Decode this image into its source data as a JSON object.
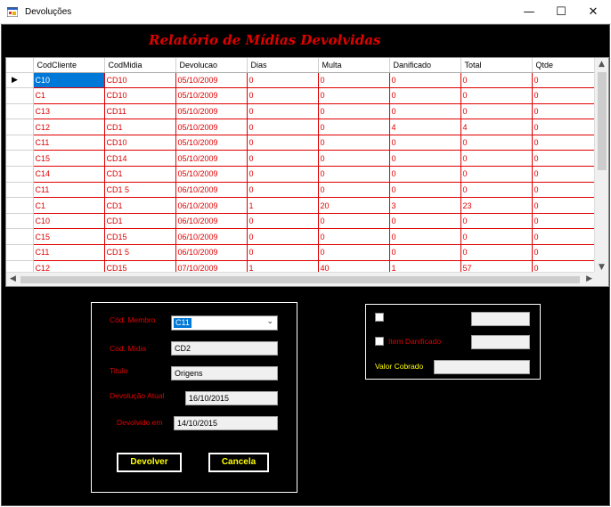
{
  "window": {
    "title": "Devoluções",
    "minimize": "—",
    "maximize": "☐",
    "close": "✕"
  },
  "report": {
    "title": "Relatório de Mídias Devolvidas"
  },
  "grid": {
    "columns": [
      "CodCliente",
      "CodMidia",
      "Devolucao",
      "Dias",
      "Multa",
      "Danificado",
      "Total",
      "Qtde"
    ],
    "current_row_marker": "▶",
    "rows": [
      [
        "C10",
        "CD10",
        "05/10/2009",
        "0",
        "0",
        "0",
        "0",
        "0"
      ],
      [
        "C1",
        "CD10",
        "05/10/2009",
        "0",
        "0",
        "0",
        "0",
        "0"
      ],
      [
        "C13",
        "CD11",
        "05/10/2009",
        "0",
        "0",
        "0",
        "0",
        "0"
      ],
      [
        "C12",
        "CD1",
        "05/10/2009",
        "0",
        "0",
        "4",
        "4",
        "0"
      ],
      [
        "C11",
        "CD10",
        "05/10/2009",
        "0",
        "0",
        "0",
        "0",
        "0"
      ],
      [
        "C15",
        "CD14",
        "05/10/2009",
        "0",
        "0",
        "0",
        "0",
        "0"
      ],
      [
        "C14",
        "CD1",
        "05/10/2009",
        "0",
        "0",
        "0",
        "0",
        "0"
      ],
      [
        "C11",
        "CD1 5",
        "06/10/2009",
        "0",
        "0",
        "0",
        "0",
        "0"
      ],
      [
        "C1",
        "CD1",
        "06/10/2009",
        "1",
        "20",
        "3",
        "23",
        "0"
      ],
      [
        "C10",
        "CD1",
        "06/10/2009",
        "0",
        "0",
        "0",
        "0",
        "0"
      ],
      [
        "C15",
        "CD15",
        "06/10/2009",
        "0",
        "0",
        "0",
        "0",
        "0"
      ],
      [
        "C11",
        "CD1 5",
        "06/10/2009",
        "0",
        "0",
        "0",
        "0",
        "0"
      ],
      [
        "C12",
        "CD15",
        "07/10/2009",
        "1",
        "40",
        "1",
        "57",
        "0"
      ]
    ]
  },
  "form": {
    "cod_membro_label": "Cód. Membro",
    "cod_membro_value": "C11",
    "cod_midia_label": "Cod. Mídia",
    "cod_midia_value": "CD2",
    "titulo_label": "Titulo",
    "titulo_value": "Origens",
    "devolucao_atual_label": "Devolução Atual",
    "devolucao_atual_value": "16/10/2015",
    "devolvido_em_label": "Devolvido em",
    "devolvido_em_value": "14/10/2015",
    "devolver_button": "Devolver",
    "cancela_button": "Cancela"
  },
  "extra": {
    "item_danificado_label": "Item Danificado",
    "valor_cobrado_label": "Valor Cobrado"
  }
}
